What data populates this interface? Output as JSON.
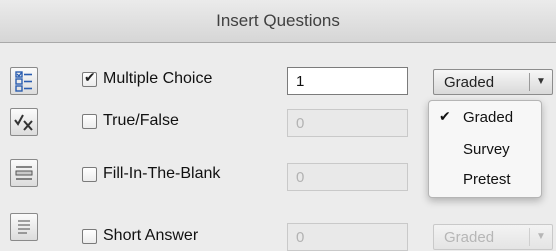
{
  "window": {
    "title": "Insert Questions"
  },
  "questions": [
    {
      "icon": "multiple-choice-icon",
      "label": "Multiple Choice",
      "checked": true,
      "count": "1",
      "enabled": true,
      "type": "Graded"
    },
    {
      "icon": "true-false-icon",
      "label": "True/False",
      "checked": false,
      "count": "0",
      "enabled": false
    },
    {
      "icon": "fill-in-blank-icon",
      "label": "Fill-In-The-Blank",
      "checked": false,
      "count": "0",
      "enabled": false
    },
    {
      "icon": "short-answer-icon",
      "label": "Short Answer",
      "checked": false,
      "count": "0",
      "enabled": false,
      "type": "Graded"
    }
  ],
  "type_dropdown": {
    "options": [
      "Graded",
      "Survey",
      "Pretest"
    ],
    "selected": "Graded"
  }
}
